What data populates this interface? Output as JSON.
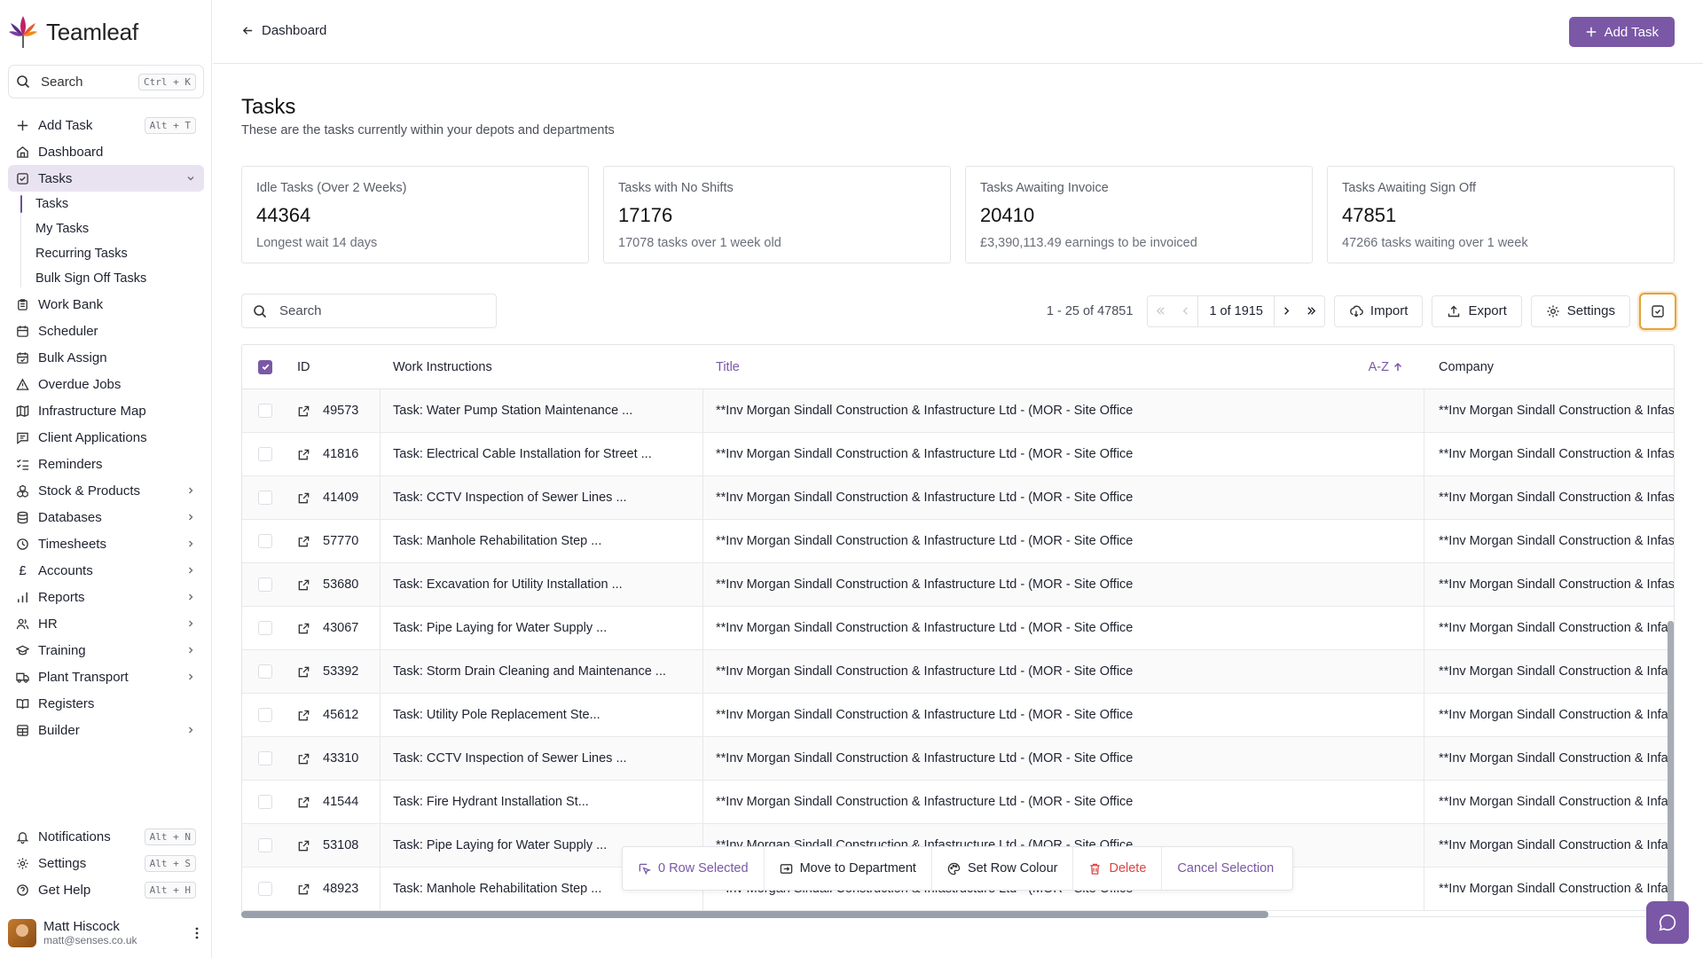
{
  "app": {
    "name": "Teamleaf"
  },
  "sidebar": {
    "search_placeholder": "Search",
    "search_shortcut": "Ctrl + K",
    "add_task": {
      "label": "Add Task",
      "shortcut": "Alt + T"
    },
    "dashboard": "Dashboard",
    "tasks": "Tasks",
    "task_sub": [
      "Tasks",
      "My Tasks",
      "Recurring Tasks",
      "Bulk Sign Off Tasks"
    ],
    "items": [
      "Work Bank",
      "Scheduler",
      "Bulk Assign",
      "Overdue Jobs",
      "Infrastructure Map",
      "Client Applications",
      "Reminders",
      "Stock & Products",
      "Databases",
      "Timesheets",
      "Accounts",
      "Reports",
      "HR",
      "Training",
      "Plant Transport",
      "Registers",
      "Builder"
    ],
    "bottom": [
      {
        "label": "Notifications",
        "shortcut": "Alt + N"
      },
      {
        "label": "Settings",
        "shortcut": "Alt + S"
      },
      {
        "label": "Get Help",
        "shortcut": "Alt + H"
      }
    ],
    "user": {
      "name": "Matt Hiscock",
      "email": "matt@senses.co.uk"
    }
  },
  "topbar": {
    "back_label": "Dashboard",
    "add_task_label": "Add Task"
  },
  "page": {
    "title": "Tasks",
    "subtitle": "These are the tasks currently within your depots and departments"
  },
  "cards": [
    {
      "label": "Idle Tasks (Over 2 Weeks)",
      "value": "44364",
      "note": "Longest wait 14 days"
    },
    {
      "label": "Tasks with No Shifts",
      "value": "17176",
      "note": "17078 tasks over 1 week old"
    },
    {
      "label": "Tasks Awaiting Invoice",
      "value": "20410",
      "note": "£3,390,113.49 earnings to be invoiced"
    },
    {
      "label": "Tasks Awaiting Sign Off",
      "value": "47851",
      "note": "47266 tasks waiting over 1 week"
    }
  ],
  "table_toolbar": {
    "search_placeholder": "Search",
    "range": "1 - 25 of 47851",
    "page": "1 of 1915",
    "import": "Import",
    "export": "Export",
    "settings": "Settings"
  },
  "table": {
    "headers": {
      "id": "ID",
      "work_instructions": "Work Instructions",
      "title": "Title",
      "sort": "A-Z",
      "company": "Company"
    },
    "title_text": "**Inv Morgan Sindall Construction & Infastructure Ltd - (MOR - Site Office",
    "company_text": "**Inv Morgan Sindall Construction & Infastructure Ltd - (MOR - Site Office",
    "rows": [
      {
        "id": "49573",
        "wi": "Task: Water Pump Station Maintenance ..."
      },
      {
        "id": "41816",
        "wi": "Task: Electrical Cable Installation for Street ..."
      },
      {
        "id": "41409",
        "wi": "Task: CCTV Inspection of Sewer Lines ..."
      },
      {
        "id": "57770",
        "wi": "Task: Manhole Rehabilitation Step ..."
      },
      {
        "id": "53680",
        "wi": "Task: Excavation for Utility Installation ..."
      },
      {
        "id": "43067",
        "wi": "Task: Pipe Laying for Water Supply ..."
      },
      {
        "id": "53392",
        "wi": "Task: Storm Drain Cleaning and Maintenance ..."
      },
      {
        "id": "45612",
        "wi": "Task: Utility Pole Replacement Ste..."
      },
      {
        "id": "43310",
        "wi": "Task: CCTV Inspection of Sewer Lines ..."
      },
      {
        "id": "41544",
        "wi": "Task: Fire Hydrant Installation St..."
      },
      {
        "id": "53108",
        "wi": "Task: Pipe Laying for Water Supply ..."
      },
      {
        "id": "48923",
        "wi": "Task: Manhole Rehabilitation Step ..."
      }
    ]
  },
  "bulk_bar": {
    "selected": "0 Row Selected",
    "move": "Move to Department",
    "colour": "Set Row Colour",
    "delete": "Delete",
    "cancel": "Cancel Selection"
  },
  "colors": {
    "accent": "#7a58a6",
    "highlight": "#e3a23b",
    "danger": "#dd4444"
  }
}
